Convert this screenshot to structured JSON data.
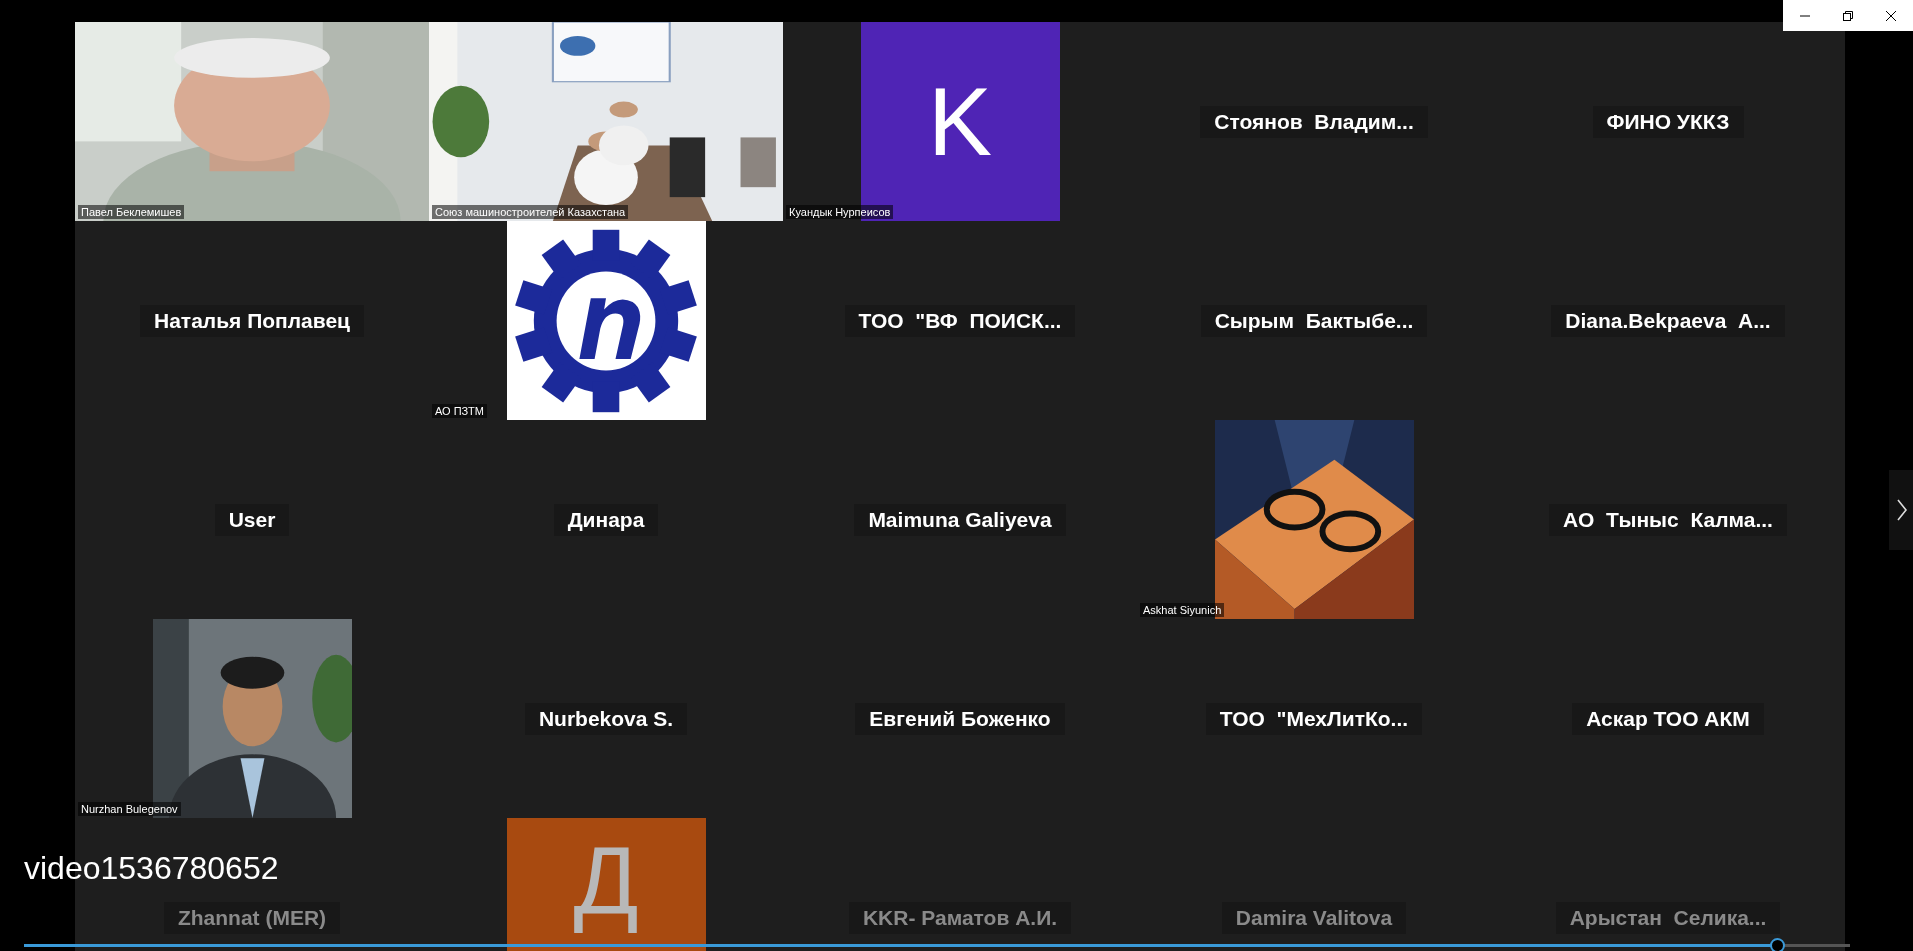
{
  "tiles": [
    {
      "kind": "video",
      "name": "Павел Беклемишев"
    },
    {
      "kind": "video",
      "name": "Союз машиностроителей Казахстана"
    },
    {
      "kind": "letter",
      "letter": "K",
      "color": "#4f24b5",
      "name": "Куандык Нурпеисов"
    },
    {
      "kind": "name",
      "name": "Стоянов  Владим..."
    },
    {
      "kind": "name",
      "name": "ФИНО УККЗ"
    },
    {
      "kind": "name",
      "name": "Наталья Поплавец"
    },
    {
      "kind": "logo",
      "name": "АО ПЗТМ"
    },
    {
      "kind": "name",
      "name": "ТОО  \"ВФ  ПОИСК..."
    },
    {
      "kind": "name",
      "name": "Сырым  Бактыбе..."
    },
    {
      "kind": "name",
      "name": "Diana.Bekpaeva  А..."
    },
    {
      "kind": "name",
      "name": "User"
    },
    {
      "kind": "name",
      "name": "Динара"
    },
    {
      "kind": "name",
      "name": "Maimuna Galiyeva"
    },
    {
      "name": "Askhat Siyunich"
    },
    {
      "kind": "name",
      "name": "АО  Тыныс  Калма..."
    },
    {
      "name": "Nurzhan Bulegenov"
    },
    {
      "kind": "name",
      "name": "Nurbekova S."
    },
    {
      "kind": "name",
      "name": "Евгений Боженко"
    },
    {
      "kind": "name",
      "name": "ТОО  \"МехЛитКо..."
    },
    {
      "kind": "name",
      "name": "Аскар ТОО АКМ"
    },
    {
      "kind": "name",
      "name": "Zhannat (MER)"
    },
    {
      "kind": "letter",
      "letter": "Д",
      "color": "#a84a10"
    },
    {
      "kind": "name",
      "name": "KKR- Раматов А.И."
    },
    {
      "kind": "name",
      "name": "Damira Valitova"
    },
    {
      "kind": "name",
      "name": "Арыстан  Селика..."
    }
  ],
  "player": {
    "title": "video1536780652",
    "level": 0.96
  }
}
